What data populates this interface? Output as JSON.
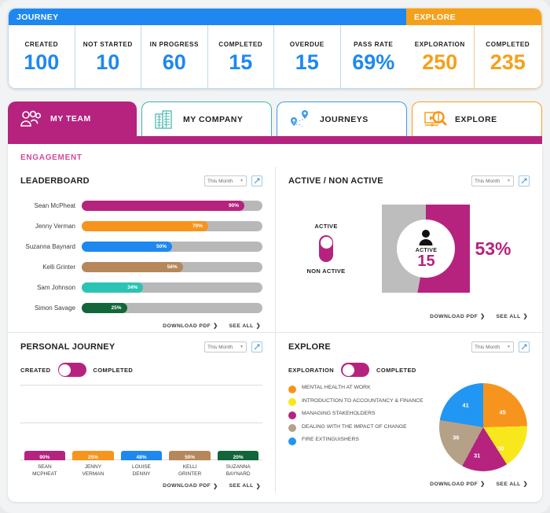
{
  "stats": {
    "journey": {
      "band_label": "JOURNEY",
      "cells": [
        {
          "label": "CREATED",
          "value": "100"
        },
        {
          "label": "NOT STARTED",
          "value": "10"
        },
        {
          "label": "IN PROGRESS",
          "value": "60"
        },
        {
          "label": "COMPLETED",
          "value": "15"
        },
        {
          "label": "OVERDUE",
          "value": "15"
        },
        {
          "label": "PASS RATE",
          "value": "69%"
        }
      ]
    },
    "explore": {
      "band_label": "EXPLORE",
      "cells": [
        {
          "label": "EXPLORATION",
          "value": "250"
        },
        {
          "label": "COMPLETED",
          "value": "235"
        }
      ]
    }
  },
  "tabs": [
    {
      "label": "MY TEAM",
      "icon": "people-icon",
      "active": true
    },
    {
      "label": "MY COMPANY",
      "icon": "building-icon",
      "active": false
    },
    {
      "label": "JOURNEYS",
      "icon": "map-pin-path-icon",
      "active": false
    },
    {
      "label": "EXPLORE",
      "icon": "video-search-icon",
      "active": false
    }
  ],
  "section_label": "ENGAGEMENT",
  "common": {
    "period_value": "This Month",
    "download_pdf": "DOWNLOAD PDF",
    "see_all": "SEE ALL",
    "chevron": "❯"
  },
  "leaderboard": {
    "title": "LEADERBOARD",
    "chart_data": {
      "type": "bar",
      "title": "LEADERBOARD",
      "orientation": "horizontal",
      "categories": [
        "Sean McPheat",
        "Jenny Verman",
        "Suzanna Baynard",
        "Kelli Grinter",
        "Sam Johnson",
        "Simon Savage"
      ],
      "values": [
        90,
        70,
        50,
        56,
        34,
        25
      ],
      "labels": [
        "90%",
        "70%",
        "50%",
        "56%",
        "34%",
        "25%"
      ],
      "colors": [
        "#b5237f",
        "#f7941e",
        "#1e88f0",
        "#b5875a",
        "#2bc4b4",
        "#12663a"
      ],
      "track_color": "#b8b8b8",
      "xlim": [
        0,
        100
      ],
      "xlabel": "",
      "ylabel": "",
      "grid": false
    }
  },
  "active_non_active": {
    "title": "ACTIVE / NON ACTIVE",
    "toggle_top": "ACTIVE",
    "toggle_bottom": "NON ACTIVE",
    "center_label": "ACTIVE",
    "center_value": "15",
    "percent_label": "53%",
    "chart_data": {
      "type": "pie",
      "subtype": "donut",
      "title": "ACTIVE / NON ACTIVE",
      "categories": [
        "Active",
        "Non Active"
      ],
      "values": [
        53,
        47
      ],
      "colors": [
        "#b5237f",
        "#bdbdbd"
      ],
      "center_text": "ACTIVE 15",
      "start_angle": 0
    }
  },
  "personal_journey": {
    "title": "PERSONAL JOURNEY",
    "toggle_left": "CREATED",
    "toggle_right": "COMPLETED",
    "chart_data": {
      "type": "bar",
      "title": "PERSONAL JOURNEY",
      "categories": [
        "SEAN MCPHEAT",
        "JENNY VERMAN",
        "LOUISE DENNY",
        "KELLI GRINTER",
        "SUZANNA BAYNARD"
      ],
      "categories_line1": [
        "SEAN",
        "JENNY",
        "LOUISE",
        "KELLI",
        "SUZANNA"
      ],
      "categories_line2": [
        "MCPHEAT",
        "VERMAN",
        "DENNY",
        "GRINTER",
        "BAYNARD"
      ],
      "values": [
        90,
        25,
        48,
        50,
        20
      ],
      "labels": [
        "90%",
        "25%",
        "48%",
        "50%",
        "20%"
      ],
      "colors": [
        "#b5237f",
        "#f7941e",
        "#1e88f0",
        "#b5875a",
        "#12663a"
      ],
      "ylim": [
        0,
        100
      ],
      "xlabel": "",
      "ylabel": "",
      "grid": true,
      "gridlines": [
        0,
        50,
        100
      ]
    }
  },
  "explore_card": {
    "title": "EXPLORE",
    "toggle_left": "EXPLORATION",
    "toggle_right": "COMPLETED",
    "chart_data": {
      "type": "pie",
      "title": "EXPLORE",
      "categories": [
        "MENTAL HEALTH AT WORK",
        "INTRODUCTION TO ACCOUNTANCY & FINANCE",
        "MANAGING STAKEHOLDERS",
        "DEALING WITH THE IMPACT OF CHANGE",
        "FIRE EXTINGUISHERS"
      ],
      "values": [
        45,
        30,
        31,
        36,
        41
      ],
      "labels": [
        "45",
        "30",
        "31",
        "36",
        "41"
      ],
      "colors": [
        "#f7941e",
        "#f9e71e",
        "#b5237f",
        "#b5a188",
        "#2196f3"
      ],
      "total": 183,
      "legend_position": "left",
      "start_angle": 0
    }
  }
}
